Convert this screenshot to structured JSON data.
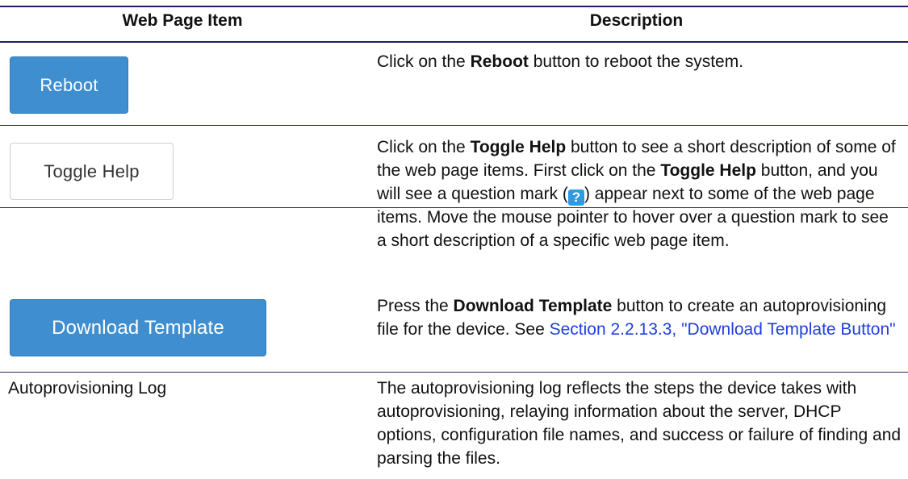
{
  "header": {
    "col1": "Web Page Item",
    "col2": "Description"
  },
  "rows": [
    {
      "button_label": "Reboot",
      "desc": {
        "t1": "Click on the ",
        "b1": "Reboot",
        "t2": " button to reboot the system."
      }
    },
    {
      "button_label": "Toggle Help",
      "desc": {
        "t1": "Click on the ",
        "b1": "Toggle Help",
        "t2": " button to see a short description of some of the web page items. First click on the ",
        "b2": "Toggle Help",
        "t3": " button, and you will see a question mark (",
        "icon": "?",
        "t4": ") appear next to some of the web page items. Move the mouse pointer to hover over a question mark to see a short description of a specific web page item."
      }
    },
    {
      "button_label": "Download Template",
      "desc": {
        "t1": "Press the ",
        "b1": "Download Template",
        "t2": " button to create an autoprovisioning file for the device. See ",
        "link": "Section 2.2.13.3, \"Download Template Button\""
      }
    },
    {
      "item_label": "Autoprovisioning Log",
      "desc": {
        "t1": "The autoprovisioning log reflects the steps the device takes with autoprovisioning, relaying information about the server, DHCP options, configuration file names, and success or failure of finding and parsing the files."
      }
    }
  ],
  "colors": {
    "rule": "#1f1f5e",
    "primary_button": "#3e8ed0",
    "link": "#1f3fe0",
    "help_icon": "#2d9be0"
  },
  "icons": {
    "help_icon": "question-mark-icon"
  }
}
